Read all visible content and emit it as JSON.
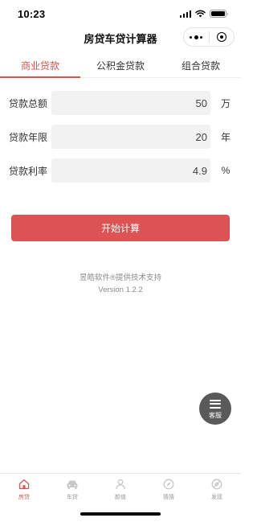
{
  "status_bar": {
    "time": "10:23"
  },
  "nav": {
    "title": "房贷车贷计算器"
  },
  "tabs": [
    {
      "label": "商业贷款",
      "active": true
    },
    {
      "label": "公积金贷款",
      "active": false
    },
    {
      "label": "组合贷款",
      "active": false
    }
  ],
  "form": {
    "amount": {
      "label": "贷款总额",
      "value": "50",
      "unit": "万"
    },
    "years": {
      "label": "贷款年限",
      "value": "20",
      "unit": "年"
    },
    "rate": {
      "label": "贷款利率",
      "value": "4.9",
      "unit": "%"
    }
  },
  "calc_button": {
    "label": "开始计算"
  },
  "footer": {
    "credit": "昱皓软件®提供技术支持",
    "version": "Version 1.2.2"
  },
  "kefu": {
    "label": "客服"
  },
  "tabbar": [
    {
      "label": "房贷",
      "icon": "home-icon",
      "active": true
    },
    {
      "label": "车贷",
      "icon": "car-icon",
      "active": false
    },
    {
      "label": "颜值",
      "icon": "person-icon",
      "active": false
    },
    {
      "label": "猜猜",
      "icon": "compass-icon",
      "active": false
    },
    {
      "label": "发现",
      "icon": "discover-icon",
      "active": false
    }
  ],
  "colors": {
    "accent": "#d9534f",
    "button": "#dd5252",
    "inactive": "#999999"
  }
}
